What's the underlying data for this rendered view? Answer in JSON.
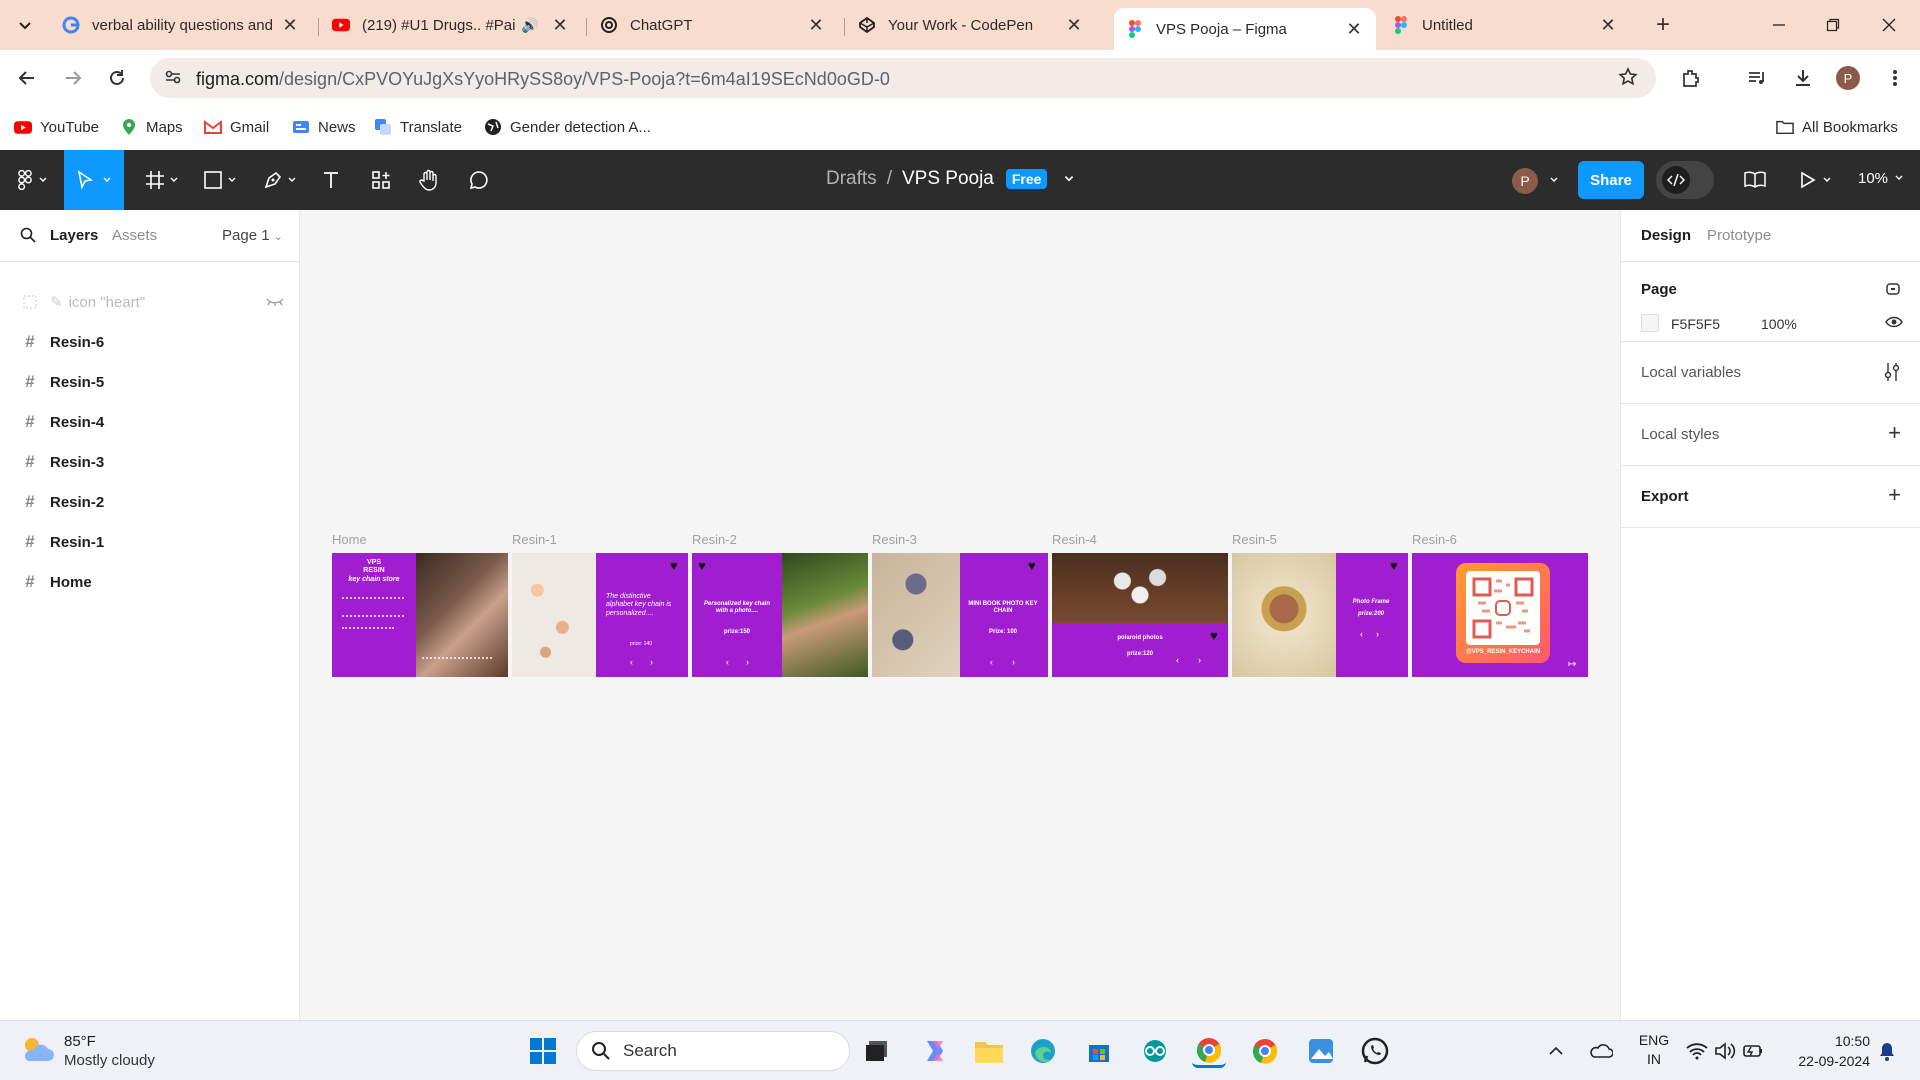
{
  "browser": {
    "tabs": [
      {
        "title": "verbal ability questions and",
        "favicon": "google-icon",
        "active": false
      },
      {
        "title": "(219) #U1 Drugs.. #Pai",
        "favicon": "youtube-icon",
        "active": false
      },
      {
        "title": "ChatGPT",
        "favicon": "chatgpt-icon",
        "active": false
      },
      {
        "title": "Your Work - CodePen",
        "favicon": "codepen-icon",
        "active": false
      },
      {
        "title": "VPS Pooja – Figma",
        "favicon": "figma-icon",
        "active": true
      },
      {
        "title": "Untitled",
        "favicon": "figma-icon",
        "active": false
      }
    ],
    "url_host": "figma.com",
    "url_path": "/design/CxPVOYuJgXsYyoHRySS8oy/VPS-Pooja?t=6m4aI19SEcNd0oGD-0",
    "bookmarks": [
      {
        "label": "YouTube",
        "icon": "youtube-icon"
      },
      {
        "label": "Maps",
        "icon": "maps-icon"
      },
      {
        "label": "Gmail",
        "icon": "gmail-icon"
      },
      {
        "label": "News",
        "icon": "news-icon"
      },
      {
        "label": "Translate",
        "icon": "translate-icon"
      },
      {
        "label": "Gender detection A...",
        "icon": "globe-icon"
      }
    ],
    "all_bookmarks": "All Bookmarks",
    "profile_initial": "P"
  },
  "figma": {
    "breadcrumb_parent": "Drafts",
    "breadcrumb_sep": "/",
    "file_name": "VPS Pooja",
    "plan": "Free",
    "user_initial": "P",
    "share": "Share",
    "zoom": "10%",
    "left_tabs": {
      "layers": "Layers",
      "assets": "Assets",
      "page": "Page 1"
    },
    "layers": [
      {
        "name": "icon \"heart\"",
        "hidden": true
      },
      {
        "name": "Resin-6",
        "hidden": false
      },
      {
        "name": "Resin-5",
        "hidden": false
      },
      {
        "name": "Resin-4",
        "hidden": false
      },
      {
        "name": "Resin-3",
        "hidden": false
      },
      {
        "name": "Resin-2",
        "hidden": false
      },
      {
        "name": "Resin-1",
        "hidden": false
      },
      {
        "name": "Home",
        "hidden": false
      }
    ],
    "frames": [
      {
        "label": "Home",
        "lines": [
          "VPS",
          "RESIN",
          "key chain store"
        ]
      },
      {
        "label": "Resin-1",
        "lines": [
          "The distinctive alphabet key chain is personalized....",
          "prize: 140"
        ]
      },
      {
        "label": "Resin-2",
        "lines": [
          "Personalized key chain with a photo....",
          "prize:150"
        ]
      },
      {
        "label": "Resin-3",
        "lines": [
          "MINI BOOK PHOTO KEY CHAIN",
          "Prize: 100"
        ]
      },
      {
        "label": "Resin-4",
        "lines": [
          "polaroid photos",
          "prize:120"
        ]
      },
      {
        "label": "Resin-5",
        "lines": [
          "Photo Frame",
          "prize:200"
        ]
      },
      {
        "label": "Resin-6",
        "lines": [
          "@VPS_RESIN_KEYCHAIN"
        ]
      }
    ],
    "right_tabs": {
      "design": "Design",
      "prototype": "Prototype"
    },
    "page_section": {
      "title": "Page",
      "color_hex": "F5F5F5",
      "opacity": "100%"
    },
    "local_variables": "Local variables",
    "local_styles": "Local styles",
    "export": "Export",
    "help": "?"
  },
  "taskbar": {
    "weather_temp": "85°F",
    "weather_desc": "Mostly cloudy",
    "search_placeholder": "Search",
    "lang_line1": "ENG",
    "lang_line2": "IN",
    "time": "10:50",
    "date": "22-09-2024"
  },
  "colors": {
    "figma_blue": "#0d99ff",
    "frame_purple": "#a01ed0",
    "canvas_bg": "#f5f5f5",
    "tab_strip": "#f8dccd"
  }
}
